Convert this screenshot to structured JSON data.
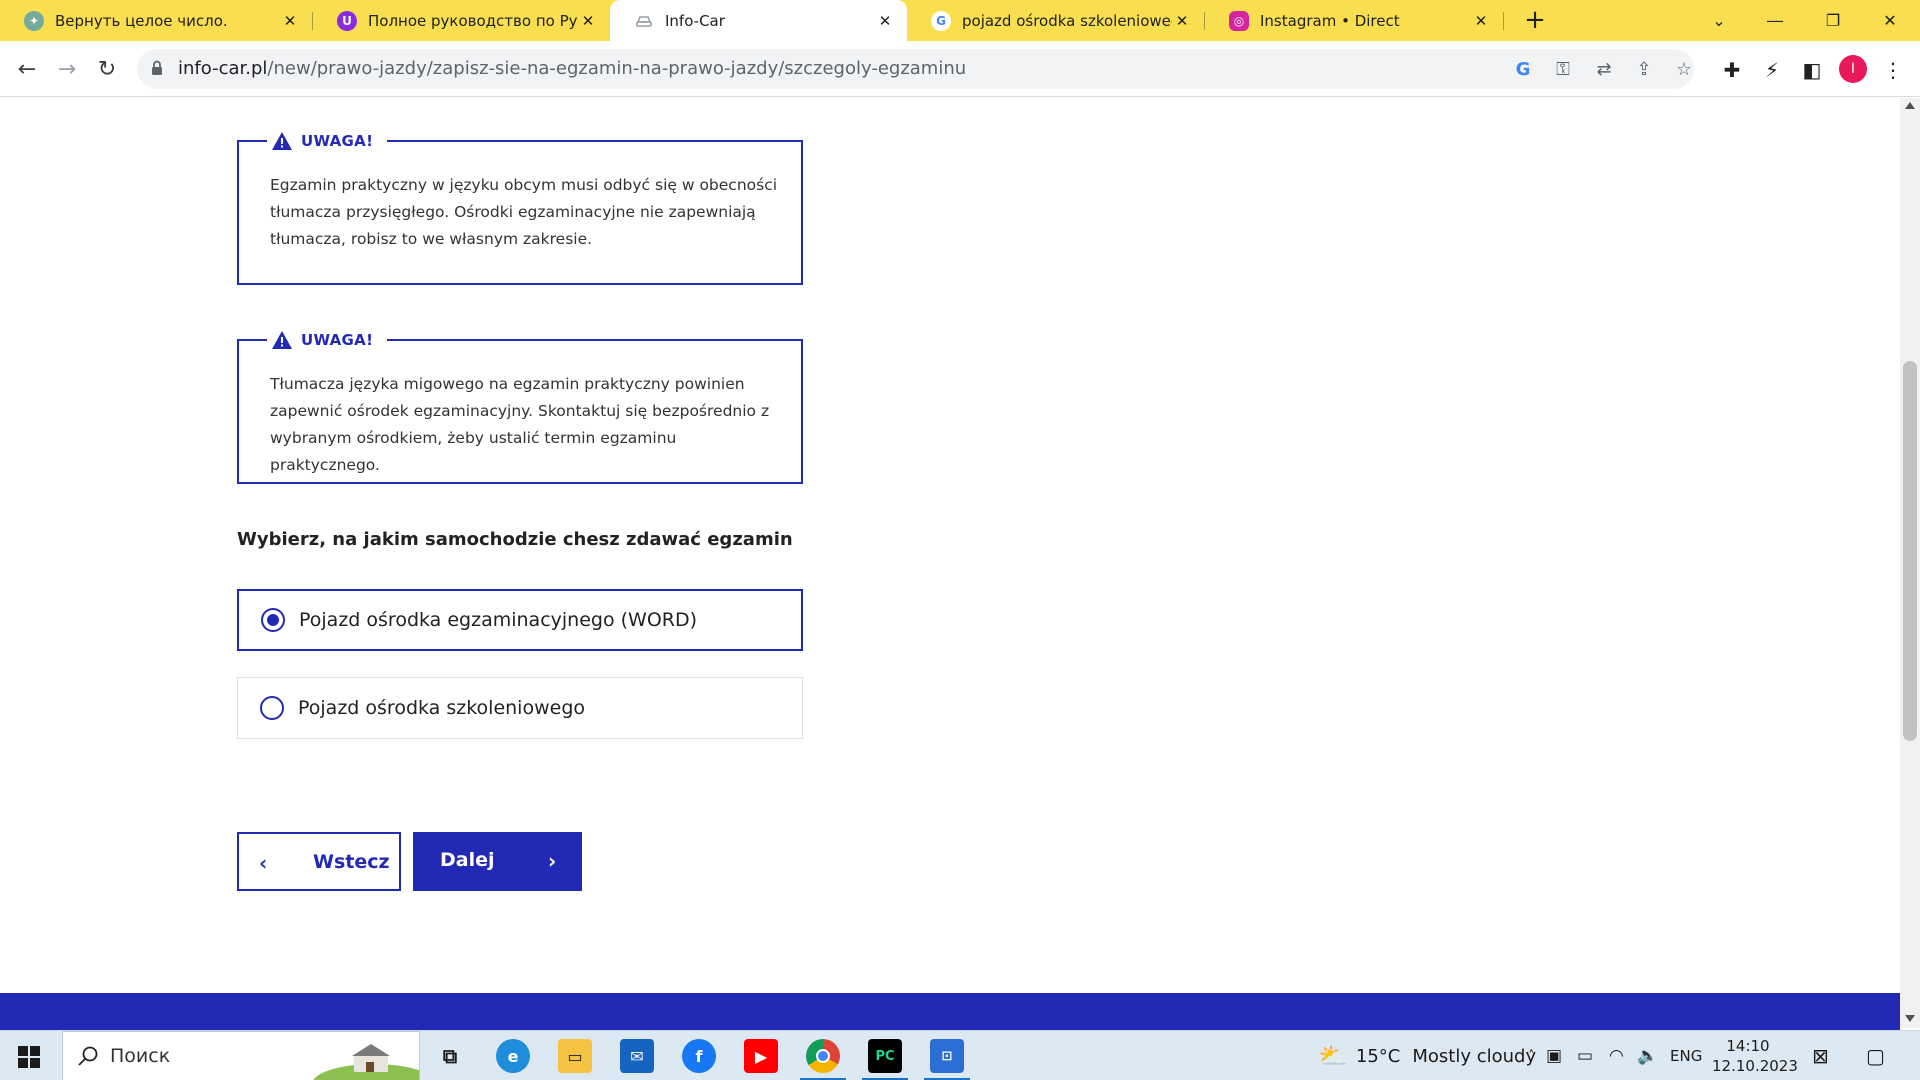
{
  "browser": {
    "tabs": [
      {
        "title": "Вернуть целое число.",
        "favicon": "chatgpt-icon",
        "active": false
      },
      {
        "title": "Полное руководство по Python",
        "favicon": "tutorial-u-icon",
        "active": false
      },
      {
        "title": "Info-Car",
        "favicon": "car-icon",
        "active": true
      },
      {
        "title": "pojazd ośrodka szkoleniowego",
        "favicon": "google-icon",
        "active": false
      },
      {
        "title": "Instagram • Direct",
        "favicon": "instagram-icon",
        "active": false
      }
    ],
    "url_domain": "info-car.pl",
    "url_path": "/new/prawo-jazdy/zapisz-sie-na-egzamin-na-prawo-jazdy/szczegoly-egzaminu",
    "profile_initial": "I",
    "tabstrip_color": "#f9df4f"
  },
  "page": {
    "accent_color": "#222ab5",
    "warnings": [
      {
        "title": "UWAGA!",
        "lines": [
          "Egzamin praktyczny w języku obcym musi odbyć się w obecności",
          "tłumacza przysięgłego. Ośrodki egzaminacyjne nie zapewniają",
          "tłumacza, robisz to we własnym zakresie."
        ]
      },
      {
        "title": "UWAGA!",
        "lines": [
          "Tłumacza języka migowego na egzamin praktyczny powinien",
          "zapewnić ośrodek egzaminacyjny. Skontaktuj się bezpośrednio z",
          "wybranym ośrodkiem, żeby ustalić termin egzaminu praktycznego."
        ]
      }
    ],
    "question": "Wybierz, na jakim samochodzie chesz zdawać egzamin",
    "options": [
      {
        "label": "Pojazd ośrodka egzaminacyjnego (WORD)",
        "selected": true
      },
      {
        "label": "Pojazd ośrodka szkoleniowego",
        "selected": false
      }
    ],
    "back_label": "Wstecz",
    "next_label": "Dalej"
  },
  "taskbar": {
    "search_placeholder": "Поиск",
    "weather_temp": "15°C",
    "weather_text": "Mostly cloudy",
    "language": "ENG",
    "time": "14:10",
    "date": "12.10.2023"
  }
}
